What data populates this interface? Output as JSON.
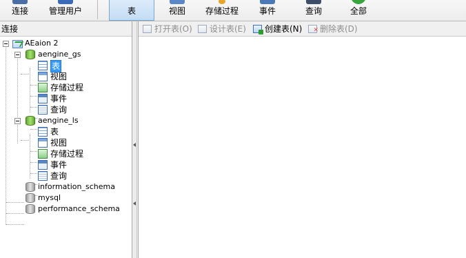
{
  "toolbar": {
    "connect": "连接",
    "manage_users": "管理用户",
    "table": "表",
    "view": "视图",
    "procedure": "存储过程",
    "event": "事件",
    "query": "查询",
    "all": "全部"
  },
  "left_panel": {
    "header": "连接",
    "connection": "AEaion 2",
    "databases": [
      {
        "name": "aengine_gs",
        "children": [
          "表",
          "视图",
          "存储过程",
          "事件",
          "查询"
        ]
      },
      {
        "name": "aengine_ls",
        "children": [
          "表",
          "视图",
          "存储过程",
          "事件",
          "查询"
        ]
      }
    ],
    "other_databases": [
      "information_schema",
      "mysql",
      "performance_schema"
    ],
    "selected_node": "aengine_gs > 表"
  },
  "object_toolbar": {
    "open_table": "打开表(O)",
    "design_table": "设计表(E)",
    "create_table": "创建表(N)",
    "delete_table": "删除表(D)"
  },
  "colors": {
    "selection": "#3399ff",
    "active_tab": "#c3dcf4"
  }
}
